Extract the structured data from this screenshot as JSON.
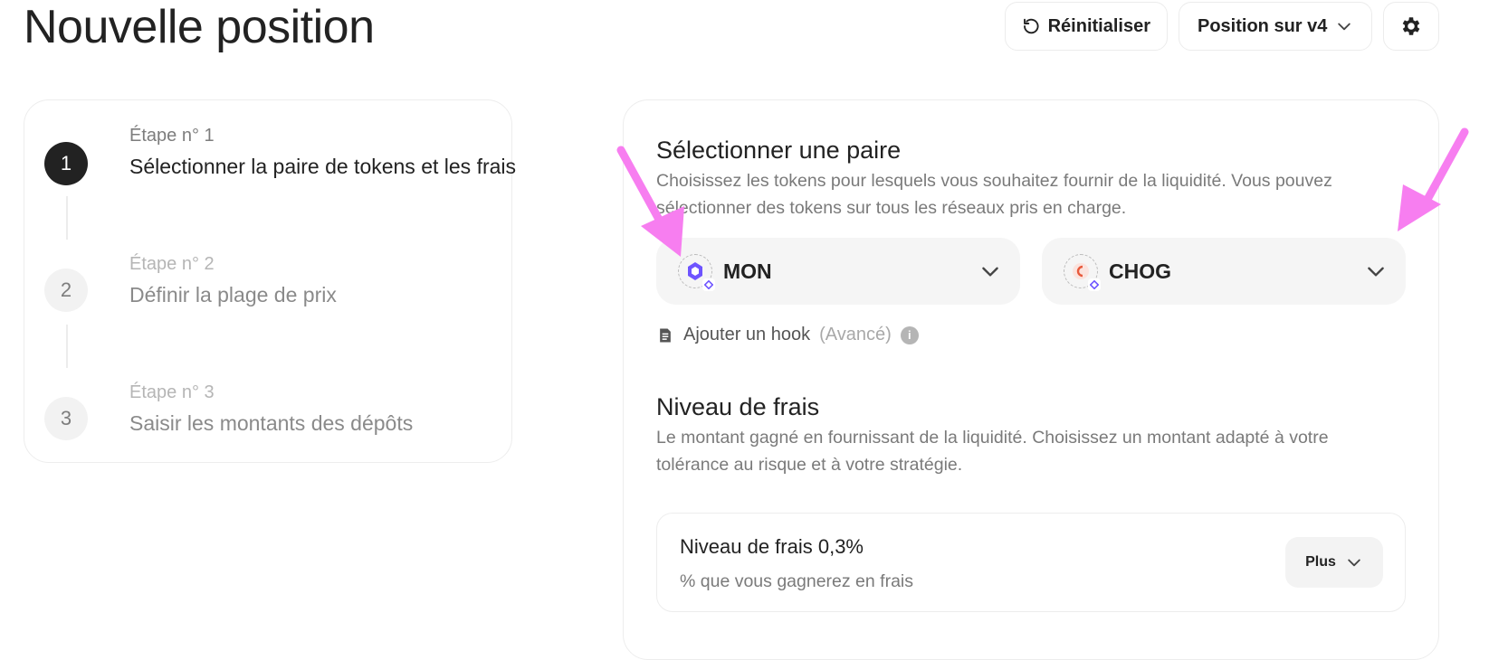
{
  "page": {
    "title": "Nouvelle position"
  },
  "header": {
    "reset_label": "Réinitialiser",
    "version_label": "Position sur v4"
  },
  "steps": [
    {
      "number": "1",
      "caption": "Étape n° 1",
      "label": "Sélectionner la paire de tokens et les frais",
      "active": true
    },
    {
      "number": "2",
      "caption": "Étape n° 2",
      "label": "Définir la plage de prix",
      "active": false
    },
    {
      "number": "3",
      "caption": "Étape n° 3",
      "label": "Saisir les montants des dépôts",
      "active": false
    }
  ],
  "pair": {
    "title": "Sélectionner une paire",
    "description": "Choisissez les tokens pour lesquels vous souhaitez fournir de la liquidité. Vous pouvez sélectionner des tokens sur tous les réseaux pris en charge.",
    "token_a": {
      "symbol": "MON",
      "icon": "mon-token-icon",
      "color": "#6e54ff"
    },
    "token_b": {
      "symbol": "CHOG",
      "icon": "chog-token-icon",
      "color": "#e85a3c"
    },
    "hook_label": "Ajouter un hook",
    "hook_advanced": "(Avancé)"
  },
  "fees": {
    "title": "Niveau de frais",
    "description": "Le montant gagné en fournissant de la liquidité. Choisissez un montant adapté à votre tolérance au risque et à votre stratégie.",
    "tier_label": "Niveau de frais 0,3%",
    "tier_sub": "% que vous gagnerez en frais",
    "more_label": "Plus"
  },
  "colors": {
    "accent_arrow": "#f77ef0",
    "active_step": "#222222"
  }
}
